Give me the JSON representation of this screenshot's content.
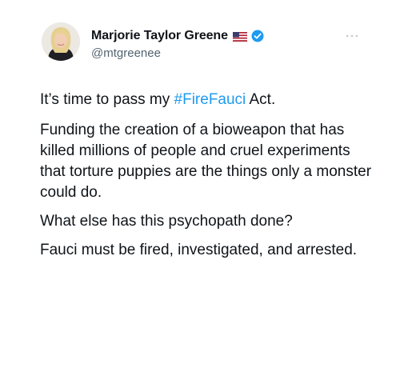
{
  "author": {
    "display_name": "Marjorie Taylor Greene",
    "handle": "@mtgreenee",
    "flag_icon": "us-flag-icon",
    "verified_icon": "verified-badge-icon",
    "verified_color": "#1d9bf0"
  },
  "menu": {
    "icon": "more-options-icon"
  },
  "tweet": {
    "line1_before": "It’s time to pass my ",
    "hashtag": "#FireFauci",
    "line1_after": " Act.",
    "paragraph2": "Funding the creation of a bioweapon that has killed millions of people and cruel experiments that torture puppies are the things only a monster could do.",
    "paragraph3": "What else has this psychopath done?",
    "paragraph4": "Fauci must be fired, investigated, and arrested."
  },
  "colors": {
    "text": "#0f1419",
    "secondary": "#536471",
    "link": "#1d9bf0"
  }
}
